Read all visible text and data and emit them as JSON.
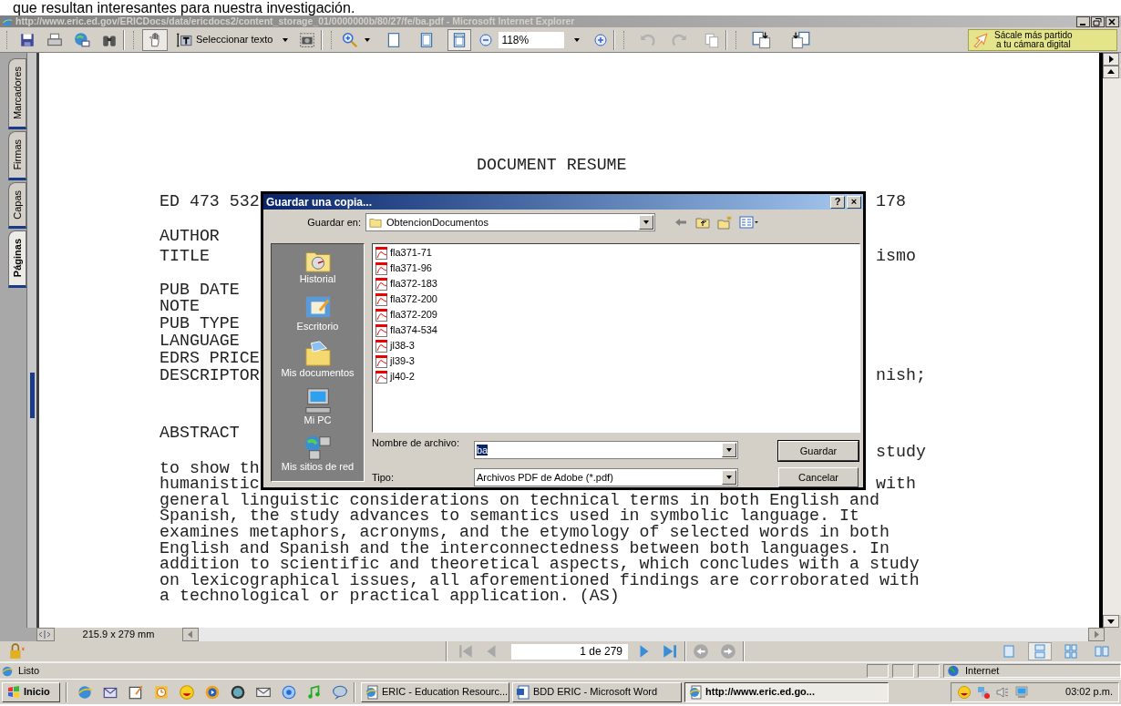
{
  "caption": "que resultan interesantes para nuestra investigación.",
  "window": {
    "title": "http://www.eric.ed.gov/ERICDocs/data/ericdocs2/content_storage_01/0000000b/80/27/fe/ba.pdf - Microsoft Internet Explorer",
    "active": false
  },
  "toolbar": {
    "tools": [
      {
        "kind": "hand",
        "selected": true
      },
      {
        "kind": "select_text",
        "label": "Seleccionar texto",
        "selected": false
      }
    ],
    "view_buttons": [
      {
        "selected": false
      },
      {
        "selected": false
      },
      {
        "selected": true
      }
    ],
    "zoom": "118%",
    "edit_buttons": [
      {
        "kind": "undo",
        "disabled": true
      },
      {
        "kind": "redo",
        "disabled": true
      },
      {
        "kind": "copy",
        "disabled": true
      }
    ],
    "promo_lines": [
      "Sácale más partido",
      "a tu cámara digital"
    ]
  },
  "side_tabs": [
    {
      "label": "Marcadores",
      "selected": false
    },
    {
      "label": "Firmas",
      "selected": false
    },
    {
      "label": "Capas",
      "selected": false
    },
    {
      "label": "Páginas",
      "selected": true
    }
  ],
  "document": {
    "heading": "DOCUMENT RESUME",
    "header_rows": [
      {
        "label": "ED 473 532",
        "value": "178"
      },
      {
        "label": "AUTHOR"
      },
      {
        "label": "TITLE",
        "value": "ismo"
      },
      {
        "label": "PUB DATE"
      },
      {
        "label": "NOTE"
      },
      {
        "label": "PUB TYPE"
      },
      {
        "label": "LANGUAGE"
      },
      {
        "label": "EDRS PRICE"
      },
      {
        "label": "DESCRIPTOR",
        "value": "nish;"
      }
    ],
    "abstract_label": "ABSTRACT",
    "abstract_rows": [
      {
        "right": "study"
      },
      {
        "left": "to show th"
      },
      {
        "left": "humanistic",
        "right": "with"
      },
      {
        "left": "general linguistic considerations on technical terms in both English and"
      },
      {
        "left": "Spanish, the study advances to semantics used in symbolic language. It"
      },
      {
        "left": "examines metaphors, acronyms, and the etymology of selected words in both"
      },
      {
        "left": "English and Spanish and the interconnectedness between both languages. In"
      },
      {
        "left": "addition to scientific and theoretical aspects, which concludes with a study"
      },
      {
        "left": "on lexicographical issues, all aforementioned findings are corroborated with"
      },
      {
        "left": "a technological or practical application. (AS)"
      }
    ]
  },
  "dialog": {
    "title": "Guardar una copia...",
    "title_buttons": [
      "?",
      "×"
    ],
    "save_in_label": "Guardar en:",
    "folder": "ObtencionDocumentos",
    "places": [
      {
        "kind": "history",
        "label": "Historial"
      },
      {
        "kind": "desktop",
        "label": "Escritorio"
      },
      {
        "kind": "documents",
        "label": "Mis documentos"
      },
      {
        "kind": "computer",
        "label": "Mi PC"
      },
      {
        "kind": "network",
        "label": "Mis sitios de red"
      }
    ],
    "files": [
      "fla371-71",
      "fla371-96",
      "fla372-183",
      "fla372-200",
      "fla372-209",
      "fla374-534",
      "jl38-3",
      "jl39-3",
      "jl40-2"
    ],
    "filename_label": "Nombre de archivo:",
    "filename": "ba",
    "filename_selected": true,
    "type_label": "Tipo:",
    "type": "Archivos PDF de Adobe (*.pdf)",
    "buttons": [
      "Guardar",
      "Cancelar"
    ]
  },
  "page_size": "215.9 x 279 mm",
  "nav": {
    "page": "1 de 279",
    "buttons": [
      {
        "kind": "first",
        "disabled": true
      },
      {
        "kind": "prev",
        "disabled": true
      },
      {
        "kind": "next",
        "disabled": false
      },
      {
        "kind": "last",
        "disabled": false
      },
      {
        "kind": "back",
        "disabled": true
      },
      {
        "kind": "forward",
        "disabled": true
      }
    ],
    "layouts": [
      {
        "selected": false
      },
      {
        "selected": true
      },
      {
        "selected": false
      },
      {
        "selected": false
      }
    ]
  },
  "status": {
    "text": "Listo",
    "zone": "Internet"
  },
  "taskbar": {
    "start": "Inicio",
    "tasks": [
      {
        "label": "ERIC - Education Resourc...",
        "selected": false
      },
      {
        "label": "BDD ERIC - Microsoft Word",
        "selected": false
      },
      {
        "label": "http://www.eric.ed.go...",
        "selected": true
      }
    ],
    "clock": "03:02 p.m."
  }
}
